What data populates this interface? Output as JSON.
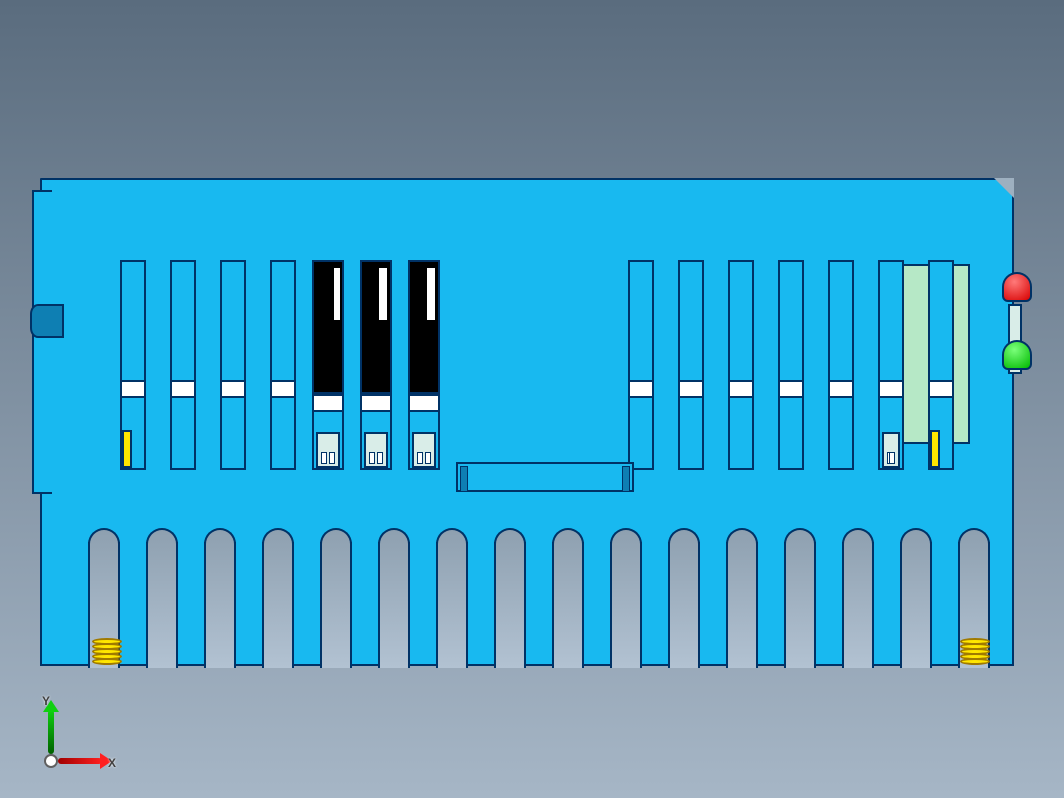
{
  "view": {
    "background_gradient_top": "#5a6c7e",
    "background_gradient_bottom": "#a6b6c6"
  },
  "model": {
    "body_color": "#18b9f0",
    "edge_color": "#003266",
    "led_red_color": "#d80000",
    "led_green_color": "#00b900",
    "spring_color": "#ffe600",
    "green_panel_color": "#b6e8c6",
    "slot_positions_left_group": [
      78,
      128,
      178,
      228,
      270,
      318,
      366
    ],
    "slot_positions_right_group": [
      586,
      636,
      686,
      736,
      786,
      836,
      886
    ],
    "black_slot_indices": [
      4,
      5,
      6
    ],
    "fin_gap_count": 16
  },
  "triad": {
    "x_label": "X",
    "y_label": "Y",
    "x_color": "#ff2020",
    "y_color": "#10d010",
    "z_color": "#2040ff"
  }
}
